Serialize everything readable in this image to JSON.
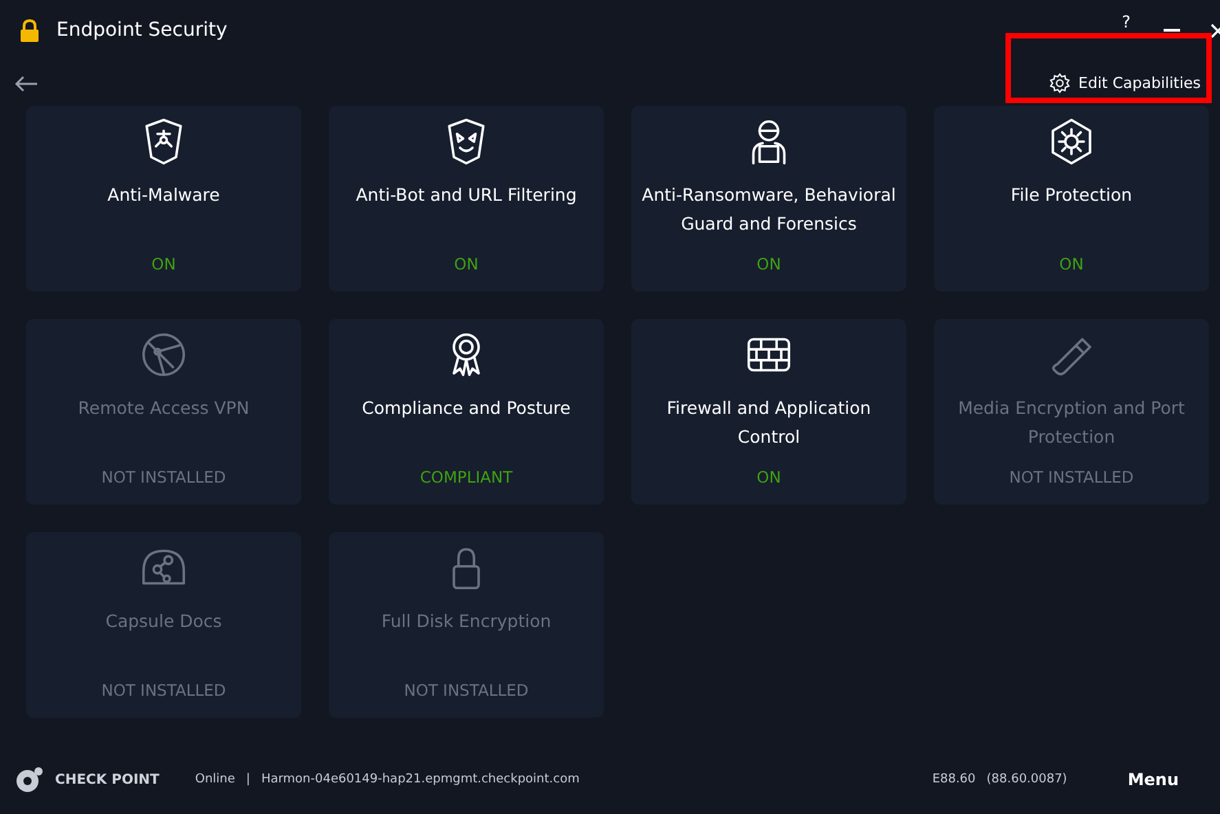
{
  "window": {
    "title": "Endpoint Security",
    "help": "?"
  },
  "toolbar": {
    "edit_button": "Edit Capabilities",
    "highlighted": true
  },
  "capabilities": [
    {
      "name": "Anti-Malware",
      "status": "ON",
      "installed": true
    },
    {
      "name": "Anti-Bot and URL Filtering",
      "status": "ON",
      "installed": true
    },
    {
      "name": "Anti-Ransomware, Behavioral Guard and Forensics",
      "status": "ON",
      "installed": true
    },
    {
      "name": "File Protection",
      "status": "ON",
      "installed": true
    },
    {
      "name": "Remote Access VPN",
      "status": "NOT INSTALLED",
      "installed": false
    },
    {
      "name": "Compliance and Posture",
      "status": "COMPLIANT",
      "installed": true
    },
    {
      "name": "Firewall and Application Control",
      "status": "ON",
      "installed": true
    },
    {
      "name": "Media Encryption and Port Protection",
      "status": "NOT INSTALLED",
      "installed": false
    },
    {
      "name": "Capsule Docs",
      "status": "NOT INSTALLED",
      "installed": false
    },
    {
      "name": "Full Disk Encryption",
      "status": "NOT INSTALLED",
      "installed": false
    }
  ],
  "status_bar": {
    "brand": "CHECK POINT",
    "connection": "Online",
    "separator": "|",
    "server": "Harmon-04e60149-hap21.epmgmt.checkpoint.com",
    "version": "E88.60",
    "build": "(88.60.0087)",
    "menu": "Menu"
  }
}
